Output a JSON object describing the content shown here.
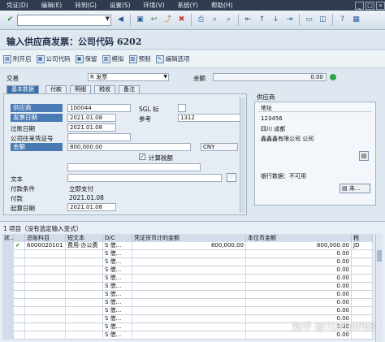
{
  "menubar": {
    "items": [
      "凭证(D)",
      "编辑(E)",
      "转到(G)",
      "设置(S)",
      "环境(V)",
      "系统(Y)",
      "帮助(H)"
    ]
  },
  "page_title": "输入供应商发票：公司代码 6202",
  "app_toolbar": {
    "buttons": [
      "附开启",
      "公司代码",
      "保留",
      "模拟",
      "预制",
      "编辑选项"
    ]
  },
  "header": {
    "transaction_label": "交易",
    "transaction_value": "R 发票",
    "balance_label": "余额",
    "balance_value": "0.00"
  },
  "tabs": [
    "基本数据",
    "付款",
    "明细",
    "税收",
    "备注"
  ],
  "form": {
    "vendor_label": "供应商",
    "vendor_value": "100044",
    "sgl_label": "SGL 标",
    "invoice_date_label": "发票日期",
    "invoice_date_value": "2021.01.08",
    "reference_label": "参考",
    "reference_value": "1312",
    "posting_date_label": "过账日期",
    "posting_date_value": "2021.01.08",
    "cross_cc_label": "公司往来凭证号",
    "amount_label": "金额",
    "amount_value": "800,000.00",
    "currency_value": "CNY",
    "calc_tax_label": "计算税额",
    "text_label": "文本",
    "payment_terms_label": "付款条件",
    "payment_terms_value": "立即支付",
    "payment_label": "付款",
    "payment_value": "2021.01.08",
    "baseline_label": "起算日期",
    "baseline_value": "2021.01.08"
  },
  "vendor_panel": {
    "title": "供应商",
    "address_label": "地址",
    "line1": "123456",
    "line2": "四川 成都",
    "line3": "鑫鑫鑫有限公司 公司",
    "bank_data": "银行数据：不可用",
    "more_button": "未..."
  },
  "items": {
    "title": "1 项目（没有选定输入变式）",
    "columns": [
      "状...",
      "总账科目",
      "短文本",
      "D/C",
      "凭证货币计的金额",
      "本位币金额",
      "税"
    ],
    "rows": [
      {
        "account": "6000020101",
        "text": "费用-办公费",
        "dc": "S 借...",
        "amount": "800,000.00",
        "local_amount": "800,000.00",
        "tax": "JD"
      },
      {
        "account": "",
        "text": "",
        "dc": "S 借...",
        "amount": "",
        "local_amount": "0.00",
        "tax": ""
      },
      {
        "account": "",
        "text": "",
        "dc": "S 借...",
        "amount": "",
        "local_amount": "0.00",
        "tax": ""
      },
      {
        "account": "",
        "text": "",
        "dc": "S 借...",
        "amount": "",
        "local_amount": "0.00",
        "tax": ""
      },
      {
        "account": "",
        "text": "",
        "dc": "S 借...",
        "amount": "",
        "local_amount": "0.00",
        "tax": ""
      },
      {
        "account": "",
        "text": "",
        "dc": "S 借...",
        "amount": "",
        "local_amount": "0.00",
        "tax": ""
      },
      {
        "account": "",
        "text": "",
        "dc": "S 借...",
        "amount": "",
        "local_amount": "0.00",
        "tax": ""
      },
      {
        "account": "",
        "text": "",
        "dc": "S 借...",
        "amount": "",
        "local_amount": "0.00",
        "tax": ""
      },
      {
        "account": "",
        "text": "",
        "dc": "S 借...",
        "amount": "",
        "local_amount": "0.00",
        "tax": ""
      },
      {
        "account": "",
        "text": "",
        "dc": "S 借...",
        "amount": "",
        "local_amount": "0.00",
        "tax": ""
      },
      {
        "account": "",
        "text": "",
        "dc": "S 借...",
        "amount": "",
        "local_amount": "0.00",
        "tax": ""
      },
      {
        "account": "",
        "text": "",
        "dc": "S 借...",
        "amount": "",
        "local_amount": "0.00",
        "tax": ""
      }
    ]
  },
  "watermark": "知乎 @TOPSAP88",
  "colors": {
    "menubar": "#2f3b4f",
    "selected": "#4a7ab4",
    "active_tab": "#3a6ea8"
  }
}
